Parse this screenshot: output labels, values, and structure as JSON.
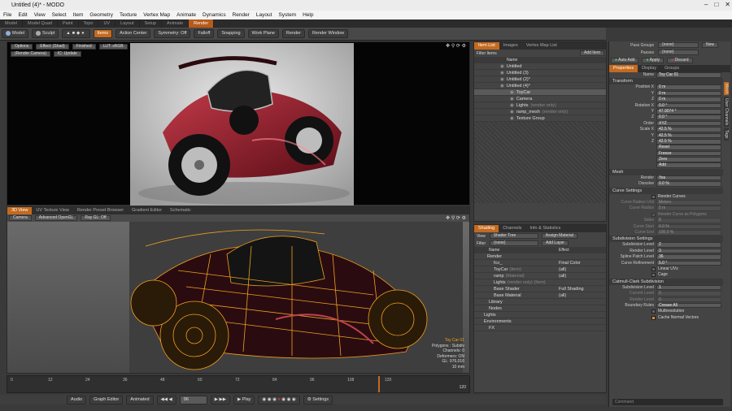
{
  "window": {
    "title": "Untitled (4)* - MODO"
  },
  "menu": [
    "File",
    "Edit",
    "View",
    "Select",
    "Item",
    "Geometry",
    "Texture",
    "Vertex Map",
    "Animate",
    "Dynamics",
    "Render",
    "Layout",
    "System",
    "Help"
  ],
  "layout_tabs": [
    "Model",
    "Model Quad",
    "Paint",
    "Topo",
    "UV",
    "Layout",
    "Setup",
    "Animate",
    "Render"
  ],
  "active_layout_tab": "Render",
  "toolbar": {
    "model": "Model",
    "sculpt": "Sculpt",
    "items": "Items",
    "action_center": "Action Center",
    "symmetry": "Symmetry: Off",
    "falloff": "Falloff",
    "snapping": "Snapping",
    "work_plane": "Work Plane",
    "render": "Render",
    "render_window": "Render Window"
  },
  "render_view": {
    "opts": [
      "Options",
      "Effect: (Shad)",
      "Finished",
      "LUT: sRGB"
    ],
    "row2": [
      "(Render Camera)",
      "IC: Update"
    ]
  },
  "view3d": {
    "tabs": [
      "3D View",
      "UV Texture View",
      "Render Preset Browser",
      "Gradient Editor",
      "Schematic"
    ],
    "buttons": [
      "Camera",
      "Advanced OpenGL",
      "Ray GL: Off"
    ],
    "info": [
      "Toy Car 01",
      "Polygons : Subdiv",
      "Channels: 0",
      "Deformers: ON",
      "GL: 976,016",
      "10 mm"
    ]
  },
  "timeline": {
    "ticks": [
      "0",
      "12",
      "24",
      "36",
      "48",
      "60",
      "72",
      "84",
      "96",
      "108",
      "120"
    ],
    "end_label": "120",
    "audio": "Audio",
    "graph_editor": "Graph Editor",
    "animated": "Animated",
    "frame": "96",
    "play": "Play",
    "settings": "Settings"
  },
  "items_panel": {
    "tabs": [
      "Item List",
      "Images",
      "Vertex Map List"
    ],
    "filter_label": "Filter Items",
    "add_item": "Add Item",
    "col_name": "Name",
    "items": [
      {
        "label": "Untitled",
        "hint": "",
        "indent": 3
      },
      {
        "label": "Untitled (3)",
        "hint": "",
        "indent": 3
      },
      {
        "label": "Untitled (2)*",
        "hint": "",
        "indent": 3
      },
      {
        "label": "Untitled (4)*",
        "hint": "",
        "indent": 3
      },
      {
        "label": "ToyCar",
        "hint": "",
        "indent": 6
      },
      {
        "label": "Camera",
        "hint": "",
        "indent": 6
      },
      {
        "label": "Lights",
        "hint": "(render only)",
        "indent": 6
      },
      {
        "label": "ramp_mesh",
        "hint": "(render only)",
        "indent": 6
      },
      {
        "label": "Texture Group",
        "hint": "",
        "indent": 6
      }
    ]
  },
  "shading_panel": {
    "tabs": [
      "Shading",
      "Channels",
      "Info & Statistics"
    ],
    "view_label": "View",
    "view_value": "Shader Tree",
    "assign": "Assign Material",
    "filter_label": "Filter",
    "filter_value": "(none)",
    "add_layer": "Add Layer",
    "col_name": "Name",
    "col_effect": "Effect",
    "rows": [
      {
        "name": "Render",
        "hint": "",
        "effect": ""
      },
      {
        "name": "fco_",
        "hint": "",
        "effect": "Final Color"
      },
      {
        "name": "ToyCar",
        "hint": "(Item)",
        "effect": "(all)"
      },
      {
        "name": "ramp",
        "hint": "(Material)",
        "effect": "(all)"
      },
      {
        "name": "Lights",
        "hint": "(render only) (Item)",
        "effect": ""
      },
      {
        "name": "Base Shader",
        "hint": "",
        "effect": "Full Shading"
      },
      {
        "name": "Base Material",
        "hint": "",
        "effect": "(all)"
      },
      {
        "name": "Library",
        "hint": "",
        "effect": ""
      },
      {
        "name": "Nodes",
        "hint": "",
        "effect": ""
      },
      {
        "name": "Lights",
        "hint": "",
        "effect": ""
      },
      {
        "name": "Environments",
        "hint": "",
        "effect": ""
      },
      {
        "name": "FX",
        "hint": "",
        "effect": ""
      }
    ]
  },
  "right_panel": {
    "pass_groups": "Pass Groups",
    "passes": "Passes",
    "none": "(none)",
    "new": "New",
    "auto_add": "Auto Add",
    "apply": "Apply",
    "discard": "Discard",
    "tabs": [
      "Properties",
      "Display",
      "Groups"
    ],
    "side_tabs": [
      "Mesh",
      "User Channels",
      "Tags"
    ],
    "name_label": "Name",
    "name_value": "Toy Car 01",
    "transform": "Transform",
    "position": [
      [
        "Position X",
        "0 m"
      ],
      [
        "Y",
        "0 m"
      ],
      [
        "Z",
        "0 m"
      ]
    ],
    "rotation": [
      [
        "Rotation X",
        "0.0 °"
      ],
      [
        "Y",
        "47.9074 °"
      ],
      [
        "Z",
        "0.0 °"
      ],
      [
        "Order",
        "XYZ"
      ]
    ],
    "scale": [
      [
        "Scale X",
        "42.5 %"
      ],
      [
        "Y",
        "42.5 %"
      ],
      [
        "Z",
        "42.5 %"
      ]
    ],
    "actions": [
      "Reset",
      "Freeze",
      "Zero",
      "Add"
    ],
    "mesh": "Mesh",
    "render_row": [
      "Render",
      "Yes"
    ],
    "dissolve": [
      "Dissolve",
      "0.0 %"
    ],
    "curve_settings": "Curve Settings",
    "render_curves": "Render Curves",
    "curve_props": [
      [
        "Curve Radius Unit",
        "Meters"
      ],
      [
        "Curve Radius",
        "5 m"
      ]
    ],
    "render_curve_poly": "Render Curve as Polygons",
    "curve_props2": [
      [
        "Sides",
        "8"
      ],
      [
        "Curve Start",
        "0.0 %"
      ],
      [
        "Curve End",
        "100.0 %"
      ]
    ],
    "subdivision": "Subdivision Settings",
    "subdiv_props": [
      [
        "Subdivision Level",
        "2"
      ],
      [
        "Render Level",
        "3"
      ],
      [
        "Spline Patch Level",
        "36"
      ],
      [
        "Curve Refinement",
        "5.0 °"
      ]
    ],
    "linear_uvs": "Linear UVs",
    "cage": "Cage",
    "catmull": "Catmull-Clark Subdivision",
    "catmull_props": [
      [
        "Subdivision Level",
        "1"
      ],
      [
        "Current Level",
        "0"
      ],
      [
        "Render Level",
        "0"
      ],
      [
        "Boundary Rules",
        "Crease All"
      ]
    ],
    "multiresolution": "Multiresolution",
    "cache_normal": "Cache Normal Vectors",
    "command": "Command"
  },
  "colors": {
    "accent": "#c46a1f",
    "wire": "#f0a020",
    "car": "#8a1a26"
  }
}
